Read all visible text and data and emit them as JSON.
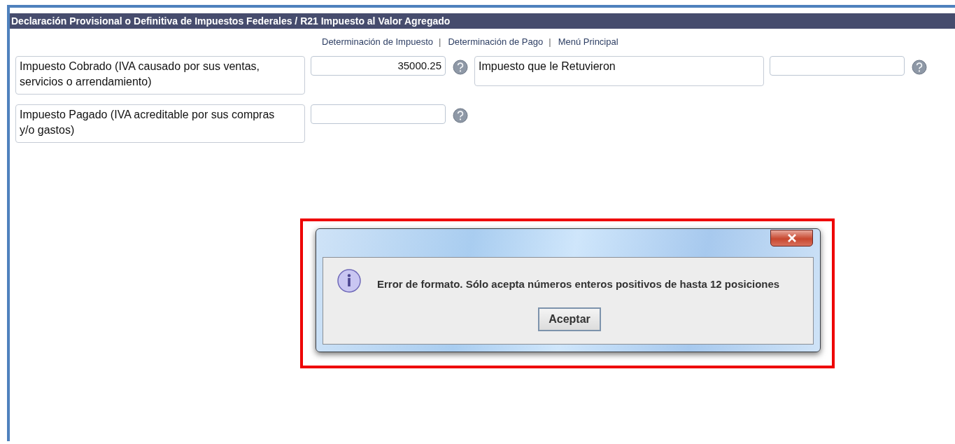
{
  "header": {
    "title": "Declaración Provisional o Definitiva de Impuestos Federales / R21 Impuesto al Valor Agregado"
  },
  "nav": [
    {
      "label": "Determinación de Impuesto",
      "separator": "|"
    },
    {
      "label": "Determinación de Pago",
      "separator": "|"
    },
    {
      "label": "Menú Principal"
    }
  ],
  "fields": [
    {
      "label": "Impuesto Cobrado (IVA causado por sus ventas, servicios o arrendamiento)",
      "value": "35000.25"
    },
    {
      "label": "Impuesto que le Retuvieron"
    },
    {
      "label": "Impuesto Pagado (IVA acreditable por sus compras y/o gastos)"
    }
  ],
  "dialog": {
    "message": "Error de formato. Sólo acepta números enteros positivos de hasta 12 posiciones",
    "button": "Aceptar",
    "highlighted": true
  }
}
